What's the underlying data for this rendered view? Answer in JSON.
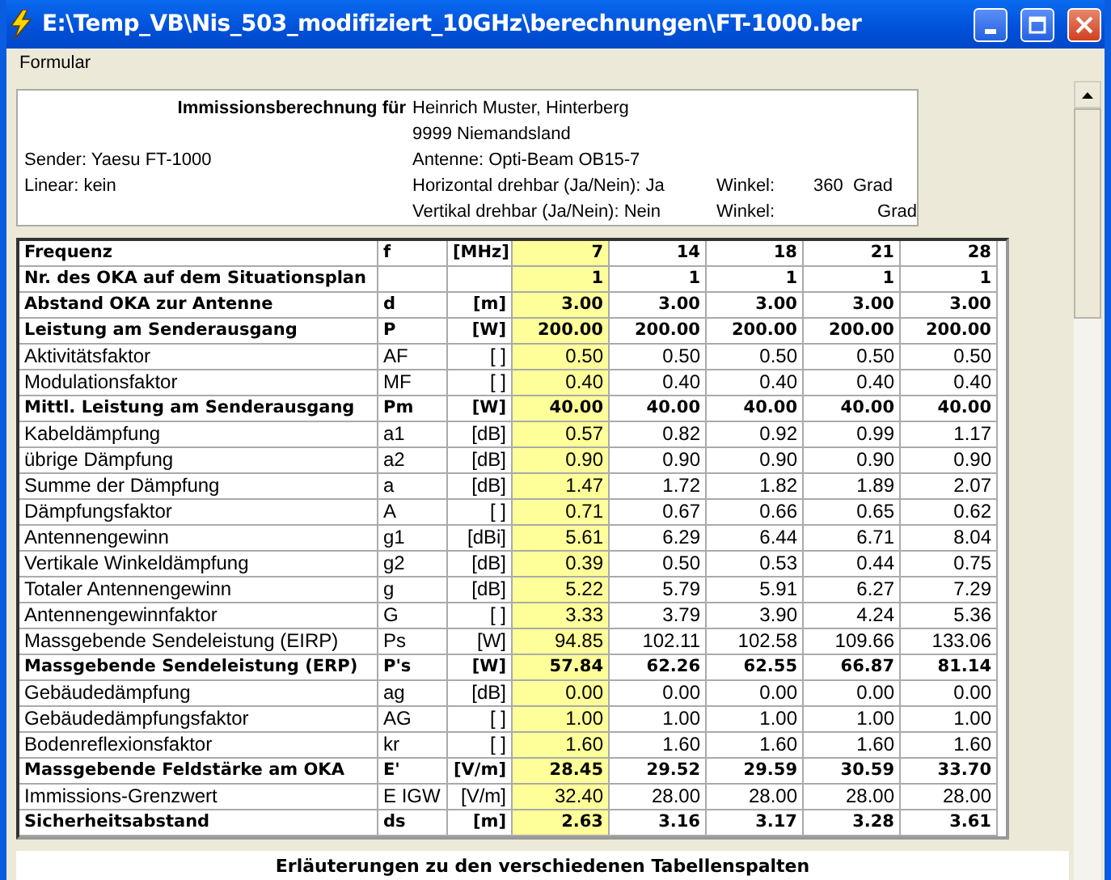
{
  "window": {
    "title": "E:\\Temp_VB\\Nis_503_modifiziert_10GHz\\berechnungen\\FT-1000.ber"
  },
  "menu": [
    "Formular"
  ],
  "header": {
    "title": "Immissionsberechnung für",
    "sender": "Sender:  Yaesu FT-1000",
    "linear": "Linear:  kein",
    "owner": "Heinrich Muster, Hinterberg",
    "address": "9999 Niemandsland",
    "antenna": "Antenne: Opti-Beam OB15-7",
    "horizontal": "Horizontal drehbar (Ja/Nein):  Ja",
    "vertical": "Vertikal drehbar (Ja/Nein):  Nein",
    "winkel_h_label": "Winkel:",
    "winkel_h_value": "360",
    "winkel_h_unit": "Grad",
    "winkel_v_label": "Winkel:",
    "winkel_v_unit": "Grad"
  },
  "table": {
    "value_columns": [
      {
        "selected": true
      },
      {
        "selected": false
      },
      {
        "selected": false
      },
      {
        "selected": false
      },
      {
        "selected": false
      }
    ],
    "rows": [
      {
        "label": "Frequenz",
        "symbol": "f",
        "unit": "[MHz]",
        "bold": true,
        "values": [
          "7",
          "14",
          "18",
          "21",
          "28"
        ]
      },
      {
        "label": "Nr. des OKA auf dem Situationsplan",
        "symbol": "",
        "unit": "",
        "bold": true,
        "values": [
          "1",
          "1",
          "1",
          "1",
          "1"
        ]
      },
      {
        "label": "Abstand OKA zur Antenne",
        "symbol": "d",
        "unit": "[m]",
        "bold": true,
        "values": [
          "3.00",
          "3.00",
          "3.00",
          "3.00",
          "3.00"
        ]
      },
      {
        "label": "Leistung am Senderausgang",
        "symbol": "P",
        "unit": "[W]",
        "bold": true,
        "values": [
          "200.00",
          "200.00",
          "200.00",
          "200.00",
          "200.00"
        ]
      },
      {
        "label": "Aktivitätsfaktor",
        "symbol": "AF",
        "unit": "[ ]",
        "bold": false,
        "values": [
          "0.50",
          "0.50",
          "0.50",
          "0.50",
          "0.50"
        ]
      },
      {
        "label": "Modulationsfaktor",
        "symbol": "MF",
        "unit": "[ ]",
        "bold": false,
        "values": [
          "0.40",
          "0.40",
          "0.40",
          "0.40",
          "0.40"
        ]
      },
      {
        "label": "Mittl. Leistung am Senderausgang",
        "symbol": "Pm",
        "unit": "[W]",
        "bold": true,
        "values": [
          "40.00",
          "40.00",
          "40.00",
          "40.00",
          "40.00"
        ]
      },
      {
        "label": "Kabeldämpfung",
        "symbol": "a1",
        "unit": "[dB]",
        "bold": false,
        "values": [
          "0.57",
          "0.82",
          "0.92",
          "0.99",
          "1.17"
        ]
      },
      {
        "label": "übrige Dämpfung",
        "symbol": "a2",
        "unit": "[dB]",
        "bold": false,
        "values": [
          "0.90",
          "0.90",
          "0.90",
          "0.90",
          "0.90"
        ]
      },
      {
        "label": "Summe der Dämpfung",
        "symbol": "a",
        "unit": "[dB]",
        "bold": false,
        "values": [
          "1.47",
          "1.72",
          "1.82",
          "1.89",
          "2.07"
        ]
      },
      {
        "label": "Dämpfungsfaktor",
        "symbol": "A",
        "unit": "[ ]",
        "bold": false,
        "values": [
          "0.71",
          "0.67",
          "0.66",
          "0.65",
          "0.62"
        ]
      },
      {
        "label": "Antennengewinn",
        "symbol": "g1",
        "unit": "[dBi]",
        "bold": false,
        "values": [
          "5.61",
          "6.29",
          "6.44",
          "6.71",
          "8.04"
        ]
      },
      {
        "label": "Vertikale Winkeldämpfung",
        "symbol": "g2",
        "unit": "[dB]",
        "bold": false,
        "values": [
          "0.39",
          "0.50",
          "0.53",
          "0.44",
          "0.75"
        ]
      },
      {
        "label": "Totaler Antennengewinn",
        "symbol": "g",
        "unit": "[dB]",
        "bold": false,
        "values": [
          "5.22",
          "5.79",
          "5.91",
          "6.27",
          "7.29"
        ]
      },
      {
        "label": "Antennengewinnfaktor",
        "symbol": "G",
        "unit": "[ ]",
        "bold": false,
        "values": [
          "3.33",
          "3.79",
          "3.90",
          "4.24",
          "5.36"
        ]
      },
      {
        "label": "Massgebende Sendeleistung (EIRP)",
        "symbol": "Ps",
        "unit": "[W]",
        "bold": false,
        "values": [
          "94.85",
          "102.11",
          "102.58",
          "109.66",
          "133.06"
        ]
      },
      {
        "label": "Massgebende Sendeleistung  (ERP)",
        "symbol": "P's",
        "unit": "[W]",
        "bold": true,
        "values": [
          "57.84",
          "62.26",
          "62.55",
          "66.87",
          "81.14"
        ]
      },
      {
        "label": "Gebäudedämpfung",
        "symbol": "ag",
        "unit": "[dB]",
        "bold": false,
        "values": [
          "0.00",
          "0.00",
          "0.00",
          "0.00",
          "0.00"
        ]
      },
      {
        "label": "Gebäudedämpfungsfaktor",
        "symbol": "AG",
        "unit": "[ ]",
        "bold": false,
        "values": [
          "1.00",
          "1.00",
          "1.00",
          "1.00",
          "1.00"
        ]
      },
      {
        "label": "Bodenreflexionsfaktor",
        "symbol": "kr",
        "unit": "[ ]",
        "bold": false,
        "values": [
          "1.60",
          "1.60",
          "1.60",
          "1.60",
          "1.60"
        ]
      },
      {
        "label": "Massgebende Feldstärke am OKA",
        "symbol": "E'",
        "unit": "[V/m]",
        "bold": true,
        "values": [
          "28.45",
          "29.52",
          "29.59",
          "30.59",
          "33.70"
        ]
      },
      {
        "label": "Immissions-Grenzwert",
        "symbol": "E IGW",
        "unit": "[V/m]",
        "bold": false,
        "values": [
          "32.40",
          "28.00",
          "28.00",
          "28.00",
          "28.00"
        ]
      },
      {
        "label": "Sicherheitsabstand",
        "symbol": "ds",
        "unit": "[m]",
        "bold": true,
        "values": [
          "2.63",
          "3.16",
          "3.17",
          "3.28",
          "3.61"
        ]
      }
    ]
  },
  "notes": {
    "title": "Erläuterungen zu den verschiedenen Tabellenspalten"
  }
}
